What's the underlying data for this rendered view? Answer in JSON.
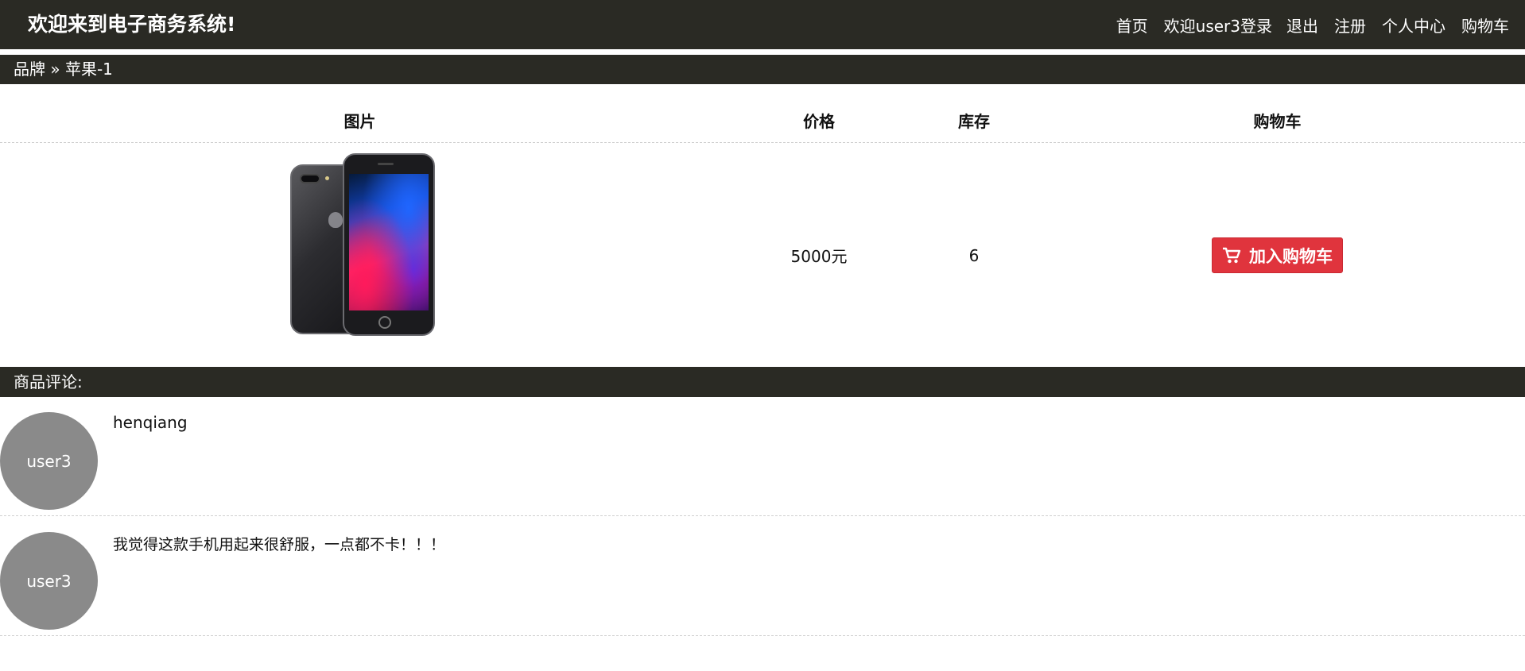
{
  "header": {
    "title": "欢迎来到电子商务系统!",
    "nav": {
      "home": "首页",
      "welcome": "欢迎user3登录",
      "logout": "退出",
      "register": "注册",
      "profile": "个人中心",
      "cart": "购物车"
    }
  },
  "breadcrumb": {
    "text": "品牌 » 苹果-1"
  },
  "product_table": {
    "columns": [
      "图片",
      "价格",
      "库存",
      "购物车"
    ],
    "row": {
      "price": "5000元",
      "stock": "6",
      "add_to_cart_label": "加入购物车"
    }
  },
  "comments": {
    "header": "商品评论:",
    "items": [
      {
        "user": "user3",
        "text": "henqiang"
      },
      {
        "user": "user3",
        "text": "我觉得这款手机用起来很舒服，一点都不卡！！！"
      }
    ]
  },
  "colors": {
    "bar_background": "#2a2a24",
    "cart_button": "#e0343d",
    "avatar": "#8a8a8a"
  },
  "icons": {
    "cart_button_icon": "shopping-cart-icon",
    "product_image": "iphone-product-image"
  }
}
